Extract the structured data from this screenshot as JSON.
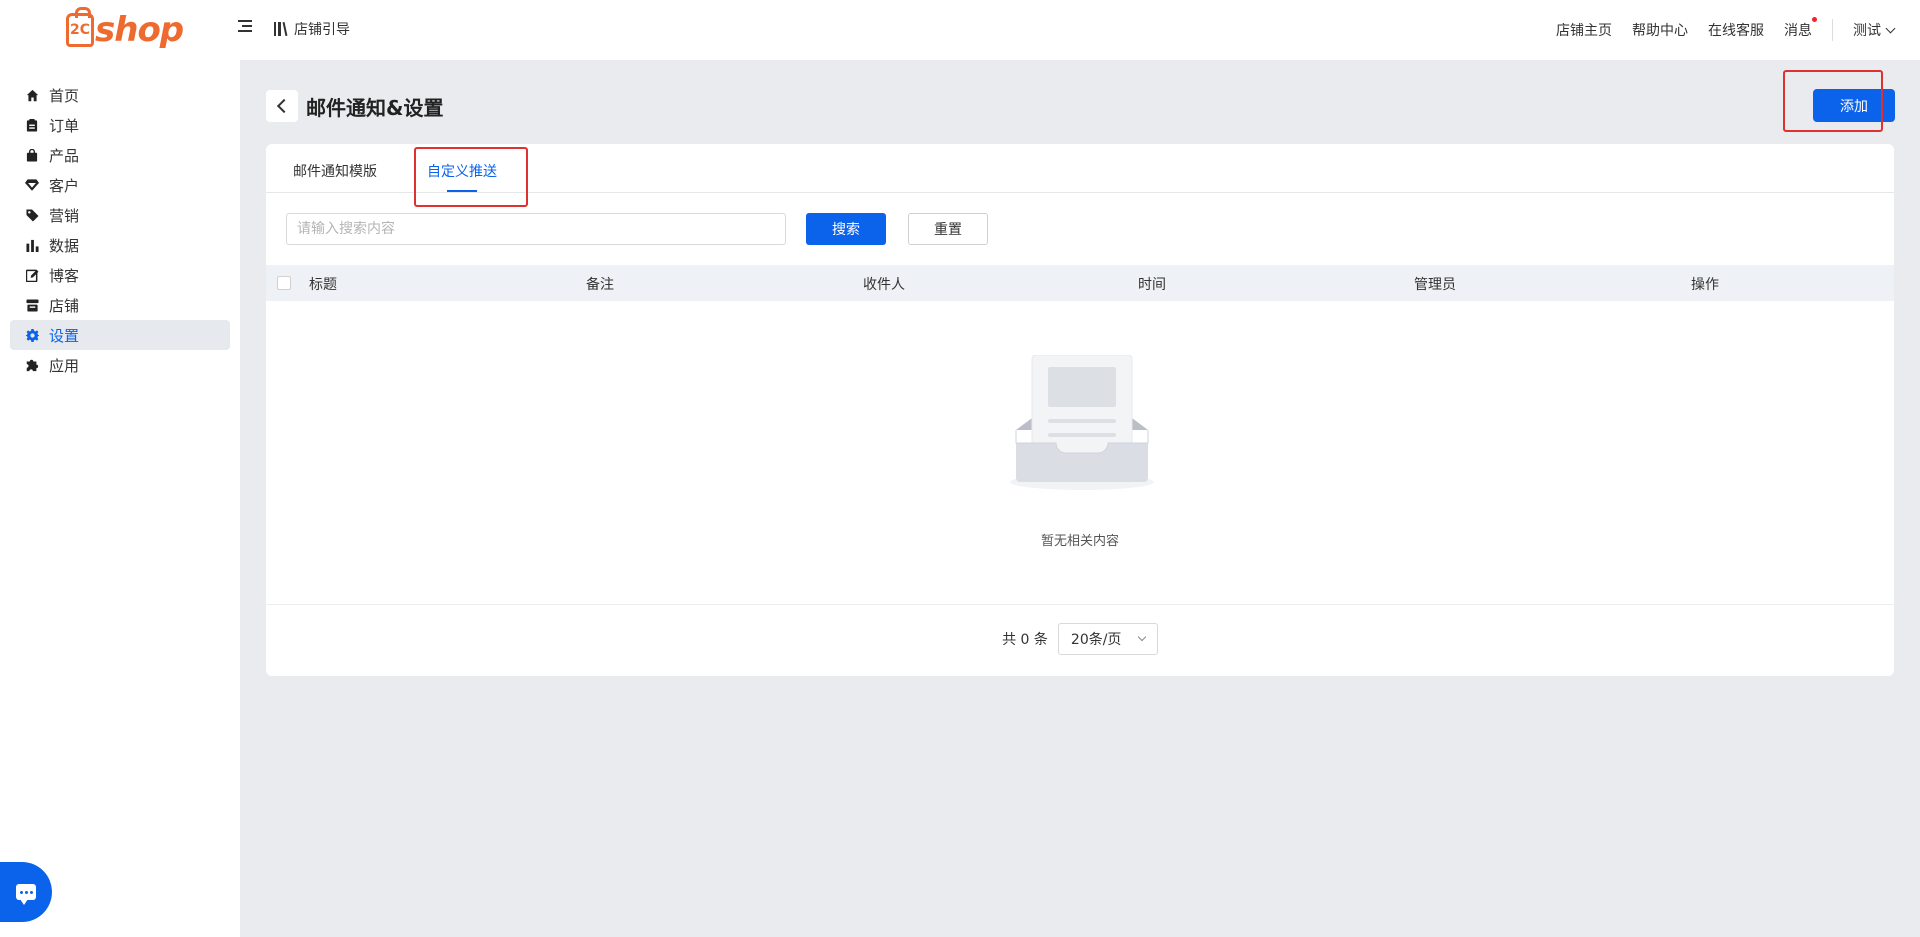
{
  "header": {
    "logo_mark": "2C",
    "logo_text": "shop",
    "guide_label": "店铺引导",
    "links": {
      "store_home": "店铺主页",
      "help_center": "帮助中心",
      "online_service": "在线客服",
      "messages": "消息"
    },
    "user_name": "测试"
  },
  "sidebar": {
    "items": [
      {
        "label": "首页",
        "icon": "home-icon"
      },
      {
        "label": "订单",
        "icon": "clipboard-icon"
      },
      {
        "label": "产品",
        "icon": "bag-icon"
      },
      {
        "label": "客户",
        "icon": "gem-icon"
      },
      {
        "label": "营销",
        "icon": "tag-icon"
      },
      {
        "label": "数据",
        "icon": "bar-chart-icon"
      },
      {
        "label": "博客",
        "icon": "edit-icon"
      },
      {
        "label": "店铺",
        "icon": "store-icon"
      },
      {
        "label": "设置",
        "icon": "gear-icon",
        "active": true
      },
      {
        "label": "应用",
        "icon": "puzzle-icon"
      }
    ]
  },
  "page": {
    "title": "邮件通知&设置",
    "add_label": "添加"
  },
  "tabs": [
    {
      "label": "邮件通知模版",
      "active": false
    },
    {
      "label": "自定义推送",
      "active": true
    }
  ],
  "search": {
    "placeholder": "请输入搜索内容",
    "search_label": "搜索",
    "reset_label": "重置"
  },
  "table": {
    "columns": [
      "标题",
      "备注",
      "收件人",
      "时间",
      "管理员",
      "操作"
    ],
    "rows": [],
    "empty_text": "暂无相关内容"
  },
  "pagination": {
    "total_text": "共 0 条",
    "page_size": "20条/页"
  },
  "colors": {
    "primary": "#0b63ec",
    "brand": "#ef6a2e",
    "highlight": "#e03131"
  }
}
